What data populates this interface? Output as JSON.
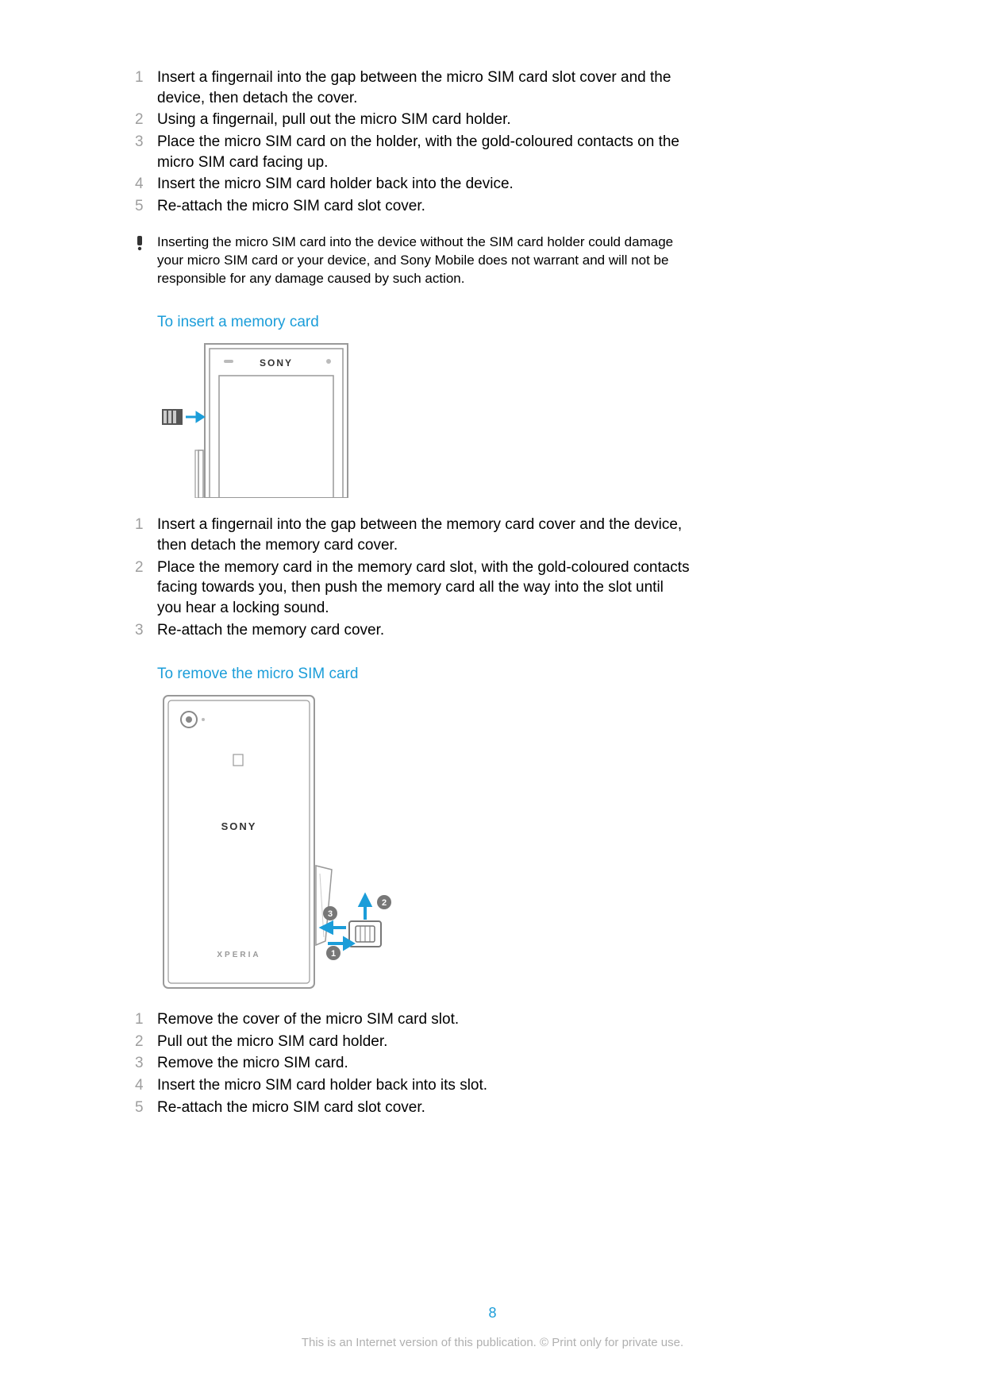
{
  "list1": {
    "items": [
      {
        "n": "1",
        "t": "Insert a fingernail into the gap between the micro SIM card slot cover and the device, then detach the cover."
      },
      {
        "n": "2",
        "t": "Using a fingernail, pull out the micro SIM card holder."
      },
      {
        "n": "3",
        "t": "Place the micro SIM card on the holder, with the gold-coloured contacts on the micro SIM card facing up."
      },
      {
        "n": "4",
        "t": "Insert the micro SIM card holder back into the device."
      },
      {
        "n": "5",
        "t": "Re-attach the micro SIM card slot cover."
      }
    ]
  },
  "warning": {
    "icon": "!",
    "text": "Inserting the micro SIM card into the device without the SIM card holder could damage your micro SIM card or your device, and Sony Mobile does not warrant and will not be responsible for any damage caused by such action."
  },
  "section2": {
    "heading": "To insert a memory card"
  },
  "list2": {
    "items": [
      {
        "n": "1",
        "t": "Insert a fingernail into the gap between the memory card cover and the device, then detach the memory card cover."
      },
      {
        "n": "2",
        "t": "Place the memory card in the memory card slot, with the gold-coloured contacts facing towards you, then push the memory card all the way into the slot until you hear a locking sound."
      },
      {
        "n": "3",
        "t": "Re-attach the memory card cover."
      }
    ]
  },
  "section3": {
    "heading": "To remove the micro SIM card"
  },
  "list3": {
    "items": [
      {
        "n": "1",
        "t": "Remove the cover of the micro SIM card slot."
      },
      {
        "n": "2",
        "t": "Pull out the micro SIM card holder."
      },
      {
        "n": "3",
        "t": "Remove the micro SIM card."
      },
      {
        "n": "4",
        "t": "Insert the micro SIM card holder back into its slot."
      },
      {
        "n": "5",
        "t": "Re-attach the micro SIM card slot cover."
      }
    ]
  },
  "illustrations": {
    "memory": {
      "brand": "SONY"
    },
    "sim_remove": {
      "brand": "SONY",
      "model": "XPERIA",
      "markers": {
        "a": "1",
        "b": "2",
        "c": "3"
      }
    }
  },
  "page_number": "8",
  "footer": "This is an Internet version of this publication. © Print only for private use."
}
